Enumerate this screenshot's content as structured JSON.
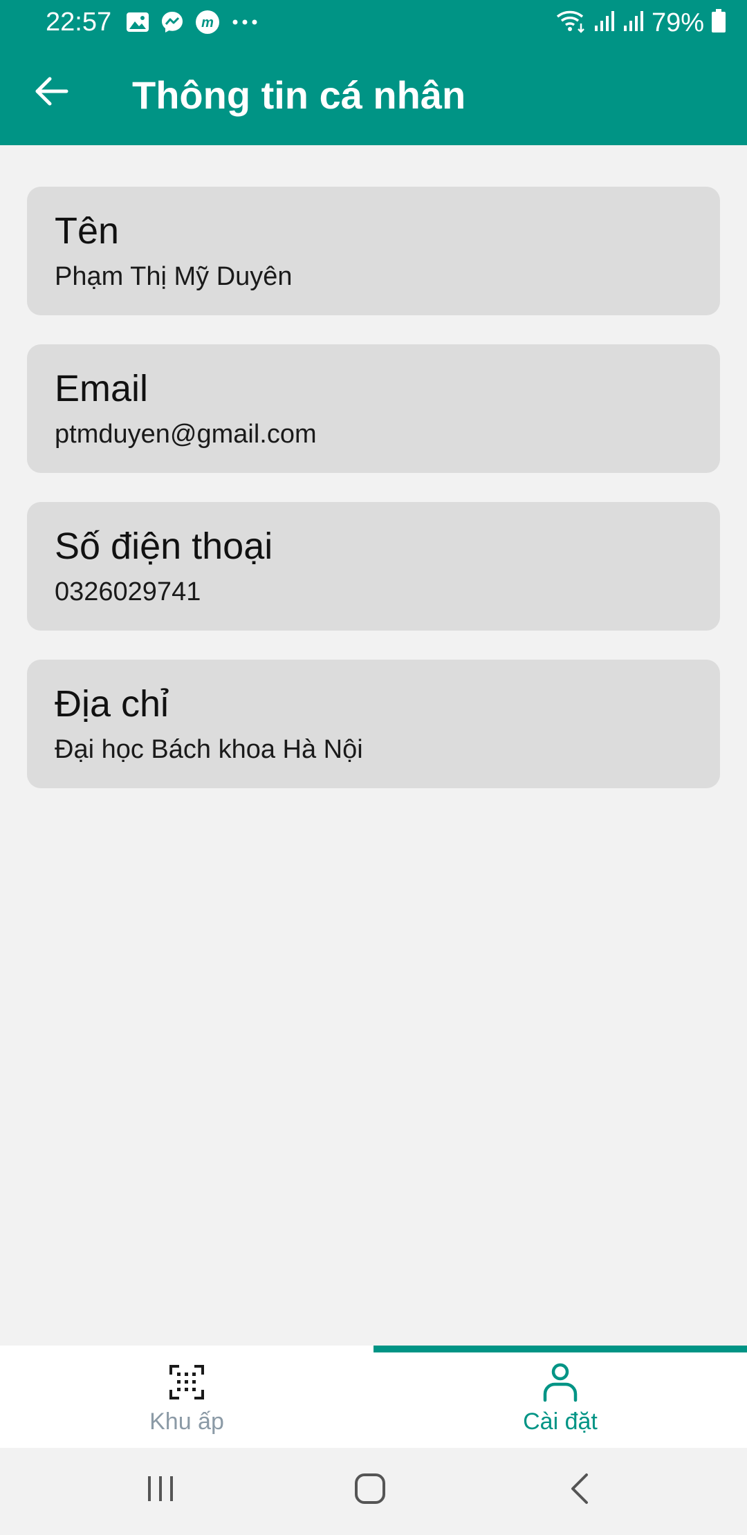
{
  "status_bar": {
    "time": "22:57",
    "battery": "79%",
    "left_icons": [
      "image-icon",
      "messenger-icon",
      "m-app-icon",
      "more-dots-icon"
    ],
    "right_icons": [
      "wifi-icon",
      "signal-icon",
      "signal-icon",
      "battery-icon"
    ]
  },
  "app_bar": {
    "title": "Thông tin cá nhân",
    "back_icon": "arrow-left-icon"
  },
  "fields": [
    {
      "label": "Tên",
      "value": "Phạm Thị Mỹ Duyên"
    },
    {
      "label": "Email",
      "value": "ptmduyen@gmail.com"
    },
    {
      "label": "Số điện thoại",
      "value": "0326029741"
    },
    {
      "label": "Địa chỉ",
      "value": "Đại học Bách khoa Hà Nội"
    }
  ],
  "bottom_nav": {
    "items": [
      {
        "label": "Khu ấp",
        "icon": "scan-icon",
        "active": false
      },
      {
        "label": "Cài đặt",
        "icon": "user-icon",
        "active": true
      }
    ]
  },
  "system_nav": {
    "buttons": [
      "recent-apps-icon",
      "home-icon",
      "back-icon"
    ]
  },
  "colors": {
    "primary": "#009485",
    "background": "#f2f2f2",
    "card": "#dcdcdc",
    "inactive": "#8b9aa6"
  }
}
